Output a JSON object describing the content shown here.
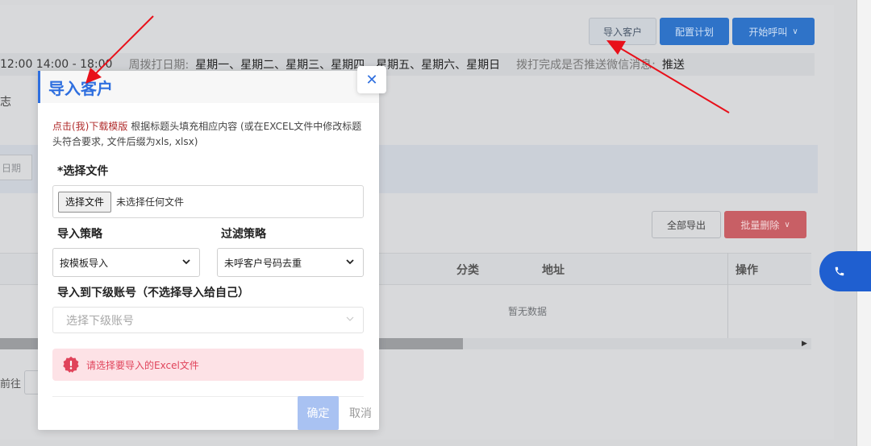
{
  "background": {
    "toolbar": {
      "import_label": "导入客户",
      "plan_label": "配置计划",
      "call_label": "开始呼叫"
    },
    "info_row": {
      "time_text": "12:00 14:00 - 18:00",
      "weekday_label": "周拨打日期:",
      "weekday_value": "星期一、星期二、星期三、星期四、星期五、星期六、星期日",
      "wechat_label": "拨打完成是否推送微信消息:",
      "wechat_value": "推送"
    },
    "tab_fragment": "志",
    "date_fragment": "日期",
    "actions": {
      "export_label": "全部导出",
      "batch_delete_label": "批量删除"
    },
    "table": {
      "columns": [
        "分类",
        "地址",
        "操作"
      ],
      "empty_text": "暂无数据"
    },
    "pagination": {
      "goto_label": "前往"
    }
  },
  "modal": {
    "title": "导入客户",
    "close_symbol": "✕",
    "tip_link": "点击(我)下载模版",
    "tip_text": " 根据标题头填充相应内容 (或在EXCEL文件中修改标题头符合要求, 文件后缀为xls, xlsx)",
    "file_label": "*选择文件",
    "file_button": "选择文件",
    "file_status": "未选择任何文件",
    "strategy_label": "导入策略",
    "strategy_value": "按模板导入",
    "filter_label": "过滤策略",
    "filter_value": "未呼客户号码去重",
    "sub_account_label": "导入到下级账号（不选择导入给自己）",
    "sub_account_placeholder": "选择下级账号",
    "alert_text": "请选择要导入的Excel文件",
    "ok_label": "确定",
    "cancel_label": "取消"
  },
  "colors": {
    "accent": "#2f6fdf",
    "annotation_arrow": "#e8101a",
    "alert_bg": "#fde2e6",
    "alert_text": "#e0435a"
  }
}
